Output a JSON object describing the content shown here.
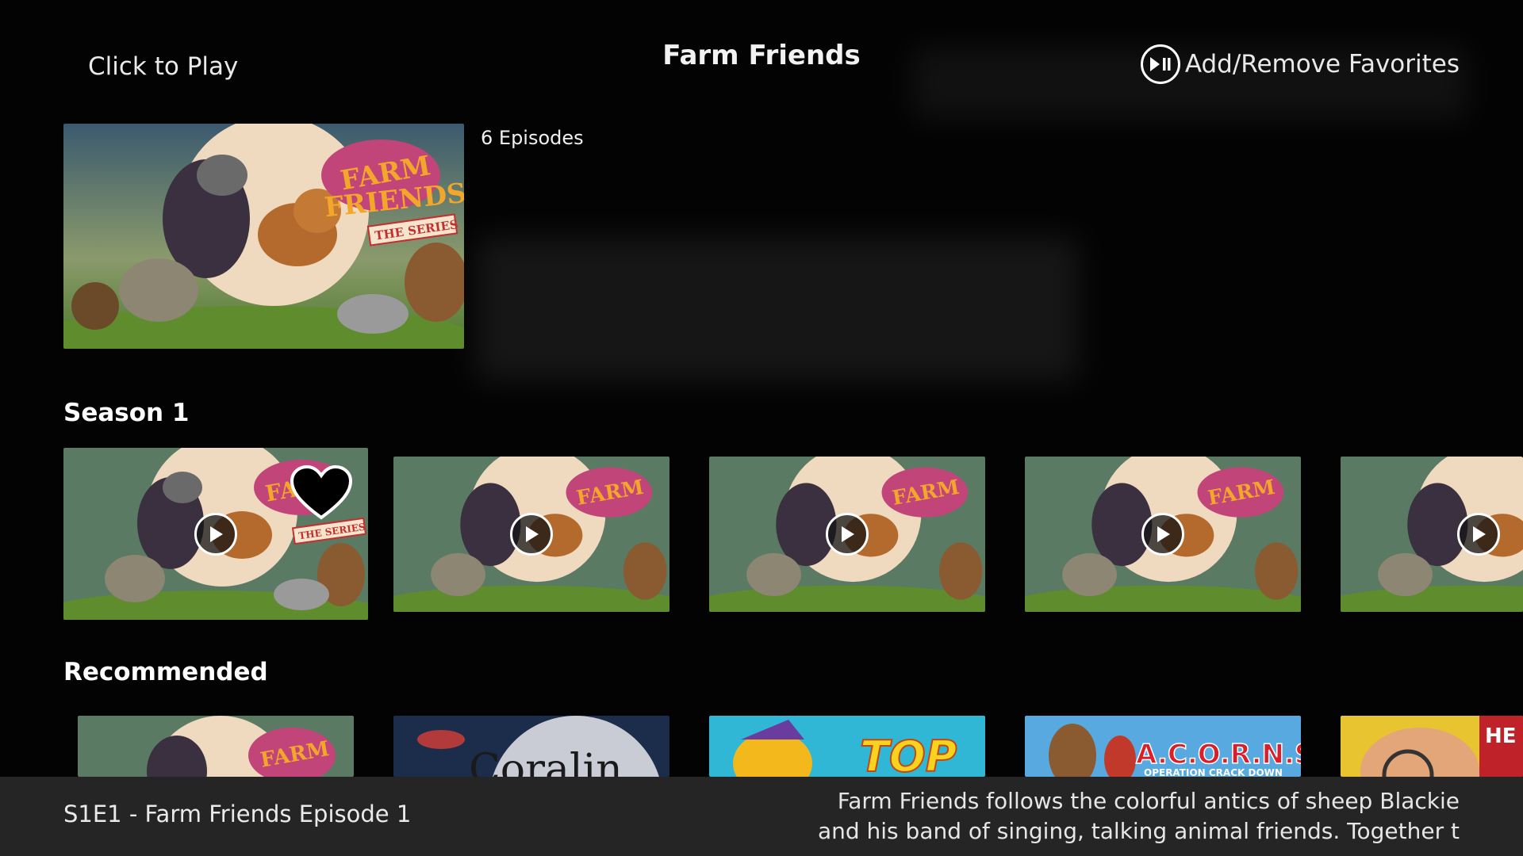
{
  "header": {
    "left_hint": "Click to Play",
    "title": "Farm Friends",
    "right_hint": "Add/Remove Favorites",
    "right_icon": "play-pause-icon"
  },
  "hero": {
    "episode_count": "6 Episodes",
    "art": "farm-friends-key-art"
  },
  "season": {
    "title": "Season 1",
    "episodes": [
      {
        "art": "farm-friends-key-art",
        "favorited": true
      },
      {
        "art": "farm-friends-key-art",
        "favorited": false
      },
      {
        "art": "farm-friends-key-art",
        "favorited": false
      },
      {
        "art": "farm-friends-key-art",
        "favorited": false
      },
      {
        "art": "farm-friends-key-art",
        "favorited": false
      }
    ]
  },
  "recommended": {
    "title": "Recommended",
    "items": [
      {
        "art": "farm-friends-key-art"
      },
      {
        "art": "coraline-art",
        "partial_text": "Coralin"
      },
      {
        "art": "top-cat-art",
        "partial_text": "TOP"
      },
      {
        "art": "acorns-art",
        "partial_text": "A.C.O.R.N.S.",
        "sub_text": "OPERATION CRACK DOWN"
      },
      {
        "art": "detective-boy-art",
        "partial_text": "HE"
      }
    ]
  },
  "info_bar": {
    "episode_label": "S1E1 - Farm Friends Episode 1",
    "synopsis_line1": "Farm Friends follows the colorful antics of sheep Blackie",
    "synopsis_line2": "and his band of singing, talking animal friends. Together t"
  },
  "colors": {
    "background": "#030303",
    "info_bar": "#2a2a2a",
    "text": "#f2f2f2"
  }
}
